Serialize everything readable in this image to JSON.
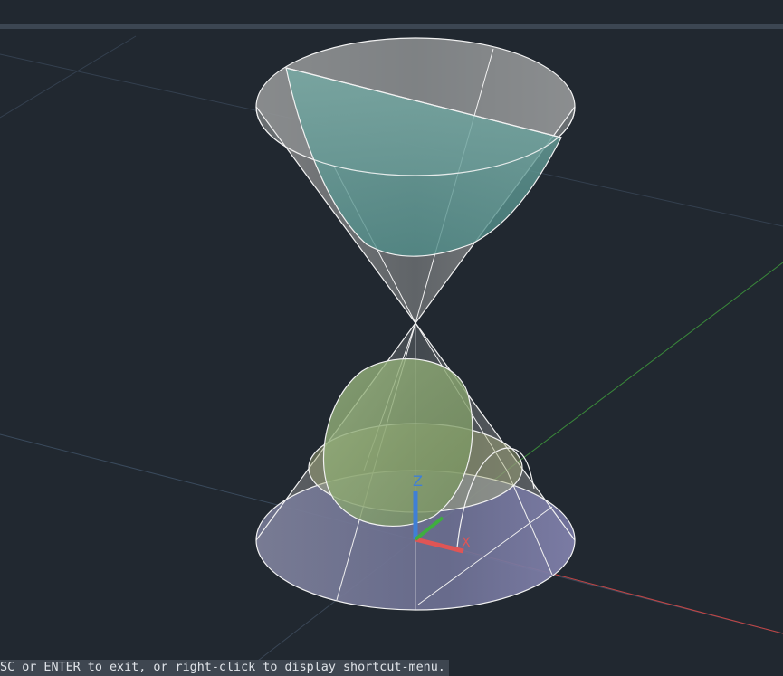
{
  "viewport": {
    "background": "#212830",
    "top_strip_color": "#3c4652"
  },
  "axes": {
    "x_label": "X",
    "y_label": "Y",
    "z_label": "Z",
    "x_color": "#e05555",
    "y_color": "#3fae3f",
    "z_color": "#3f7fd6"
  },
  "scene": {
    "object": "double-cone with conic sections",
    "upper_section_color": "#6fa8a3",
    "lower_section_color": "#8fae72",
    "base_color": "#6f7396",
    "edge_color": "#f2f2f2"
  },
  "command_line": {
    "text": "ESC or ENTER to exit, or right-click to display shortcut-menu."
  }
}
